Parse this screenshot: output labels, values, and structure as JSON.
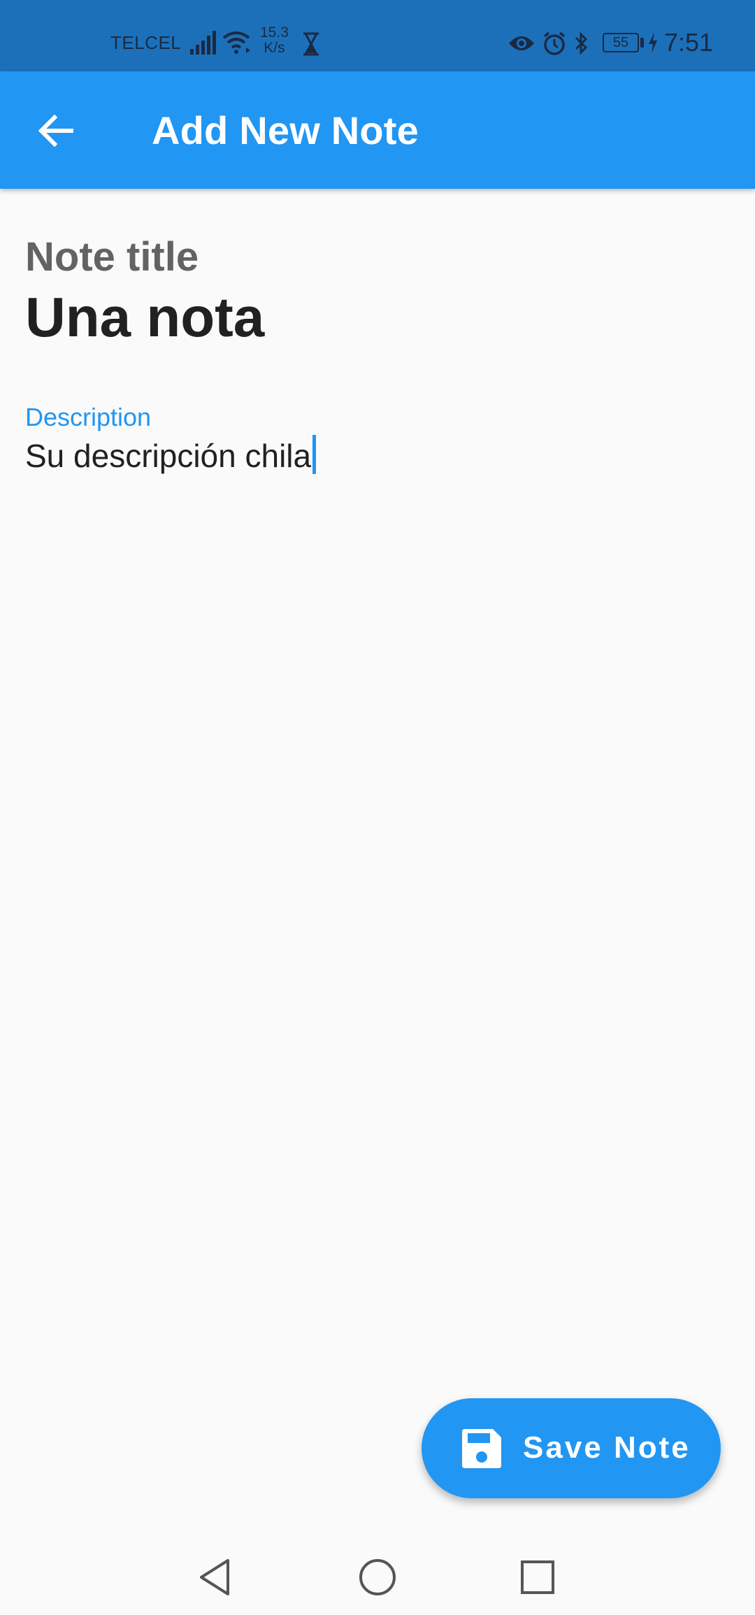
{
  "status_bar": {
    "carrier": "TELCEL",
    "speed_value": "15.3",
    "speed_unit": "K/s",
    "battery": "55",
    "time": "7:51",
    "icons": [
      "signal-icon",
      "wifi-icon",
      "hourglass-icon",
      "eye-icon",
      "alarm-icon",
      "bluetooth-icon",
      "battery-icon",
      "charging-icon"
    ]
  },
  "app_bar": {
    "title": "Add New Note",
    "back_icon": "arrow-back-icon"
  },
  "form": {
    "title_label": "Note title",
    "title_value": "Una nota",
    "description_label": "Description",
    "description_value": "Su descripción chila"
  },
  "fab": {
    "label": "Save Note",
    "icon": "save-icon"
  },
  "nav_bar": {
    "icons": [
      "back-triangle-icon",
      "home-circle-icon",
      "recents-square-icon"
    ]
  },
  "colors": {
    "primary": "#2196f3",
    "status_bar": "#1c70b9",
    "background": "#fafafa"
  }
}
